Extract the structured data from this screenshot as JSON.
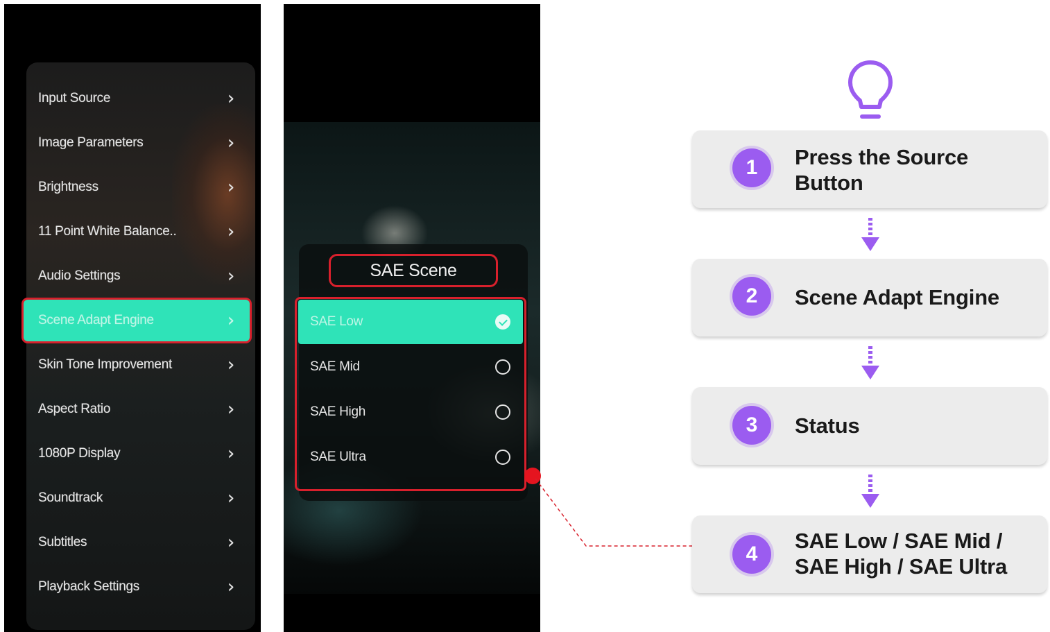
{
  "left_menu": {
    "items": [
      {
        "label": "Input Source"
      },
      {
        "label": "Image Parameters"
      },
      {
        "label": "Brightness"
      },
      {
        "label": "11 Point White Balance.."
      },
      {
        "label": "Audio Settings"
      },
      {
        "label": "Scene Adapt Engine",
        "selected": true
      },
      {
        "label": "Skin Tone Improvement"
      },
      {
        "label": "Aspect Ratio"
      },
      {
        "label": "1080P Display"
      },
      {
        "label": "Soundtrack"
      },
      {
        "label": "Subtitles"
      },
      {
        "label": "Playback Settings"
      }
    ],
    "chevron_icon": "chevron-right-icon",
    "highlight_color": "#2fe3b8",
    "annotation_color": "#d8202c"
  },
  "sae_menu": {
    "title": "SAE Scene",
    "options": [
      {
        "label": "SAE Low",
        "checked": true
      },
      {
        "label": "SAE Mid",
        "checked": false
      },
      {
        "label": "SAE High",
        "checked": false
      },
      {
        "label": "SAE Ultra",
        "checked": false
      }
    ]
  },
  "guide": {
    "icon": "lightbulb-icon",
    "accent_color": "#9b5cf0",
    "steps": [
      {
        "num": "1",
        "text": "Press the Source Button"
      },
      {
        "num": "2",
        "text": "Scene Adapt Engine"
      },
      {
        "num": "3",
        "text": "Status"
      },
      {
        "num": "4",
        "text": "SAE Low / SAE Mid / SAE High / SAE Ultra"
      }
    ]
  }
}
